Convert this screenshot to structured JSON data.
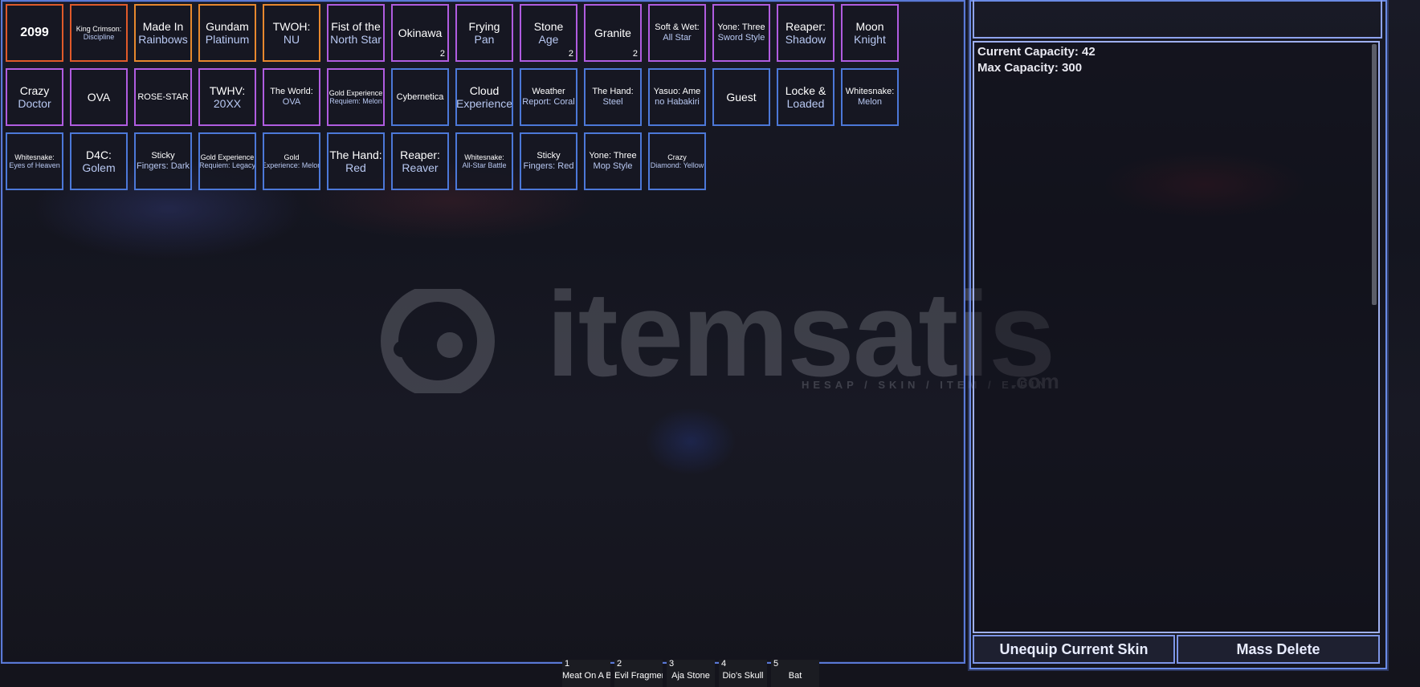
{
  "colors": {
    "panel_border": "#5a79d6",
    "rarity_mythic": "#e05a2a",
    "rarity_legendary": "#e7882e",
    "rarity_epic": "#b05ce0",
    "rarity_rare": "#4c78d8",
    "subtitle_text": "#b8c8f2"
  },
  "inventory": {
    "skins": [
      {
        "line1": "2099",
        "line2": "",
        "rarity": "mythic",
        "size": "lg",
        "count": ""
      },
      {
        "line1": "King Crimson:",
        "line2": "Discipline",
        "rarity": "mythic",
        "size": "xs",
        "count": ""
      },
      {
        "line1": "Made In",
        "line2": "Rainbows",
        "rarity": "legendary",
        "size": "md",
        "count": ""
      },
      {
        "line1": "Gundam",
        "line2": "Platinum",
        "rarity": "legendary",
        "size": "md",
        "count": ""
      },
      {
        "line1": "TWOH:",
        "line2": "NU",
        "rarity": "legendary",
        "size": "md",
        "count": ""
      },
      {
        "line1": "Fist of the",
        "line2": "North Star",
        "rarity": "epic",
        "size": "md",
        "count": ""
      },
      {
        "line1": "Okinawa",
        "line2": "",
        "rarity": "epic",
        "size": "md",
        "count": "2"
      },
      {
        "line1": "Frying",
        "line2": "Pan",
        "rarity": "epic",
        "size": "md",
        "count": ""
      },
      {
        "line1": "Stone",
        "line2": "Age",
        "rarity": "epic",
        "size": "md",
        "count": "2"
      },
      {
        "line1": "Granite",
        "line2": "",
        "rarity": "epic",
        "size": "md",
        "count": "2"
      },
      {
        "line1": "Soft & Wet:",
        "line2": "All Star",
        "rarity": "epic",
        "size": "sm",
        "count": ""
      },
      {
        "line1": "Yone: Three",
        "line2": "Sword Style",
        "rarity": "epic",
        "size": "sm",
        "count": ""
      },
      {
        "line1": "Reaper:",
        "line2": "Shadow",
        "rarity": "epic",
        "size": "md",
        "count": ""
      },
      {
        "line1": "Moon",
        "line2": "Knight",
        "rarity": "epic",
        "size": "md",
        "count": ""
      },
      {
        "line1": "Crazy",
        "line2": "Doctor",
        "rarity": "epic",
        "size": "md",
        "count": ""
      },
      {
        "line1": "OVA",
        "line2": "",
        "rarity": "epic",
        "size": "md",
        "count": ""
      },
      {
        "line1": "ROSE-STAR",
        "line2": "",
        "rarity": "epic",
        "size": "sm",
        "count": ""
      },
      {
        "line1": "TWHV:",
        "line2": "20XX",
        "rarity": "epic",
        "size": "md",
        "count": ""
      },
      {
        "line1": "The World:",
        "line2": "OVA",
        "rarity": "epic",
        "size": "sm",
        "count": ""
      },
      {
        "line1": "Gold Experience",
        "line2": "Requiem: Melon",
        "rarity": "epic",
        "size": "xs",
        "count": ""
      },
      {
        "line1": "Cybernetica",
        "line2": "",
        "rarity": "rare",
        "size": "sm",
        "count": ""
      },
      {
        "line1": "Cloud",
        "line2": "Experience",
        "rarity": "rare",
        "size": "md",
        "count": ""
      },
      {
        "line1": "Weather",
        "line2": "Report: Coral",
        "rarity": "rare",
        "size": "sm",
        "count": ""
      },
      {
        "line1": "The Hand:",
        "line2": "Steel",
        "rarity": "rare",
        "size": "sm",
        "count": ""
      },
      {
        "line1": "Yasuo: Ame",
        "line2": "no Habakiri",
        "rarity": "rare",
        "size": "sm",
        "count": ""
      },
      {
        "line1": "Guest",
        "line2": "",
        "rarity": "rare",
        "size": "md",
        "count": ""
      },
      {
        "line1": "Locke &",
        "line2": "Loaded",
        "rarity": "rare",
        "size": "md",
        "count": ""
      },
      {
        "line1": "Whitesnake:",
        "line2": "Melon",
        "rarity": "rare",
        "size": "sm",
        "count": ""
      },
      {
        "line1": "Whitesnake:",
        "line2": "Eyes of Heaven",
        "rarity": "rare",
        "size": "xs",
        "count": ""
      },
      {
        "line1": "D4C:",
        "line2": "Golem",
        "rarity": "rare",
        "size": "md",
        "count": ""
      },
      {
        "line1": "Sticky",
        "line2": "Fingers: Dark",
        "rarity": "rare",
        "size": "sm",
        "count": ""
      },
      {
        "line1": "Gold Experience",
        "line2": "Requiem: Legacy",
        "rarity": "rare",
        "size": "xs",
        "count": ""
      },
      {
        "line1": "Gold",
        "line2": "Experience: Melon",
        "rarity": "rare",
        "size": "xs",
        "count": ""
      },
      {
        "line1": "The Hand:",
        "line2": "Red",
        "rarity": "rare",
        "size": "md",
        "count": ""
      },
      {
        "line1": "Reaper:",
        "line2": "Reaver",
        "rarity": "rare",
        "size": "md",
        "count": ""
      },
      {
        "line1": "Whitesnake:",
        "line2": "All-Star Battle",
        "rarity": "rare",
        "size": "xs",
        "count": ""
      },
      {
        "line1": "Sticky",
        "line2": "Fingers: Red",
        "rarity": "rare",
        "size": "sm",
        "count": ""
      },
      {
        "line1": "Yone: Three",
        "line2": "Mop Style",
        "rarity": "rare",
        "size": "sm",
        "count": ""
      },
      {
        "line1": "Crazy",
        "line2": "Diamond: Yellow",
        "rarity": "rare",
        "size": "xs",
        "count": ""
      }
    ]
  },
  "capacity": {
    "current": "Current Capacity: 42",
    "max": "Max Capacity: 300"
  },
  "buttons": {
    "unequip": "Unequip Current Skin",
    "mass_delete": "Mass Delete"
  },
  "watermark": {
    "brand": "itemsatis",
    "tagline": "HESAP / SKIN / ITEM / E-PIN",
    "domain": ".com"
  },
  "hotbar": [
    {
      "num": "1",
      "label": "Meat On A Bone"
    },
    {
      "num": "2",
      "label": "Evil Fragment"
    },
    {
      "num": "3",
      "label": "Aja Stone"
    },
    {
      "num": "4",
      "label": "Dio's Skull"
    },
    {
      "num": "5",
      "label": "Bat"
    }
  ]
}
